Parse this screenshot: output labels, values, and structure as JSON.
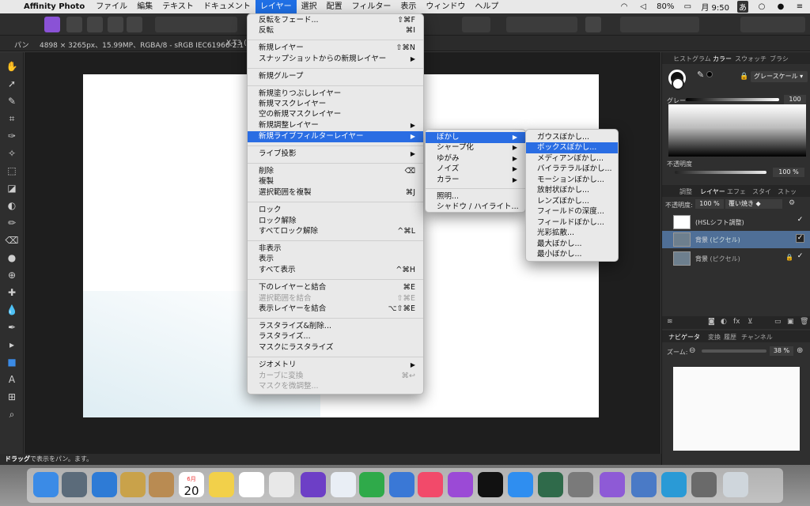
{
  "menubar": {
    "app_name": "Affinity Photo",
    "menus": [
      "ファイル",
      "編集",
      "テキスト",
      "ドキュメント",
      "レイヤー",
      "選択",
      "配置",
      "フィルター",
      "表示",
      "ウィンドウ",
      "ヘルプ"
    ],
    "active_menu": "レイヤー",
    "battery": "80%",
    "clock": "月 9:50",
    "input_method": "あ"
  },
  "contextbar": {
    "tool": "パン",
    "info": "4898 × 3265px、15.99MP、RGBA/8 - sRGB IEC61966-2.1",
    "camera": "X-T3 (X"
  },
  "status": {
    "bold": "ドラッグ",
    "rest": "で表示をパン。ます。"
  },
  "layer_menu": {
    "items": [
      {
        "label": "反転をフェード...",
        "shortcut": "⇧⌘F"
      },
      {
        "label": "反転",
        "shortcut": "⌘I"
      },
      {
        "label": "新規レイヤー",
        "shortcut": "⇧⌘N"
      },
      {
        "label": "スナップショットからの新規レイヤー",
        "arrow": "▶"
      },
      {
        "label": "新規グループ"
      },
      {
        "label": "新規塗りつぶしレイヤー"
      },
      {
        "label": "新規マスクレイヤー"
      },
      {
        "label": "空の新規マスクレイヤー"
      },
      {
        "label": "新規調整レイヤー",
        "arrow": "▶"
      },
      {
        "label": "新規ライブフィルターレイヤー",
        "arrow": "▶"
      },
      {
        "label": "ライブ投影",
        "arrow": "▶"
      },
      {
        "label": "削除",
        "shortcut": "⌫"
      },
      {
        "label": "複製"
      },
      {
        "label": "選択範囲を複製",
        "shortcut": "⌘J"
      },
      {
        "label": "ロック"
      },
      {
        "label": "ロック解除"
      },
      {
        "label": "すべてロック解除",
        "shortcut": "^⌘L"
      },
      {
        "label": "非表示"
      },
      {
        "label": "表示"
      },
      {
        "label": "すべて表示",
        "shortcut": "^⌘H"
      },
      {
        "label": "下のレイヤーと結合",
        "shortcut": "⌘E"
      },
      {
        "label": "選択範囲を結合",
        "shortcut": "⇧⌘E"
      },
      {
        "label": "表示レイヤーを結合",
        "shortcut": "⌥⇧⌘E"
      },
      {
        "label": "ラスタライズ&削除..."
      },
      {
        "label": "ラスタライズ..."
      },
      {
        "label": "マスクにラスタライズ"
      },
      {
        "label": "ジオメトリ",
        "arrow": "▶"
      },
      {
        "label": "カーブに変換",
        "shortcut": "⌘↩"
      },
      {
        "label": "マスクを微調整..."
      }
    ]
  },
  "live_filter_menu": {
    "items": [
      {
        "label": "ぼかし",
        "arrow": "▶"
      },
      {
        "label": "シャープ化",
        "arrow": "▶"
      },
      {
        "label": "ゆがみ",
        "arrow": "▶"
      },
      {
        "label": "ノイズ",
        "arrow": "▶"
      },
      {
        "label": "カラー",
        "arrow": "▶"
      },
      {
        "label": "照明..."
      },
      {
        "label": "シャドウ / ハイライト..."
      }
    ]
  },
  "blur_menu": {
    "items": [
      {
        "label": "ガウスぼかし..."
      },
      {
        "label": "ボックスぼかし..."
      },
      {
        "label": "メディアンぼかし..."
      },
      {
        "label": "バイラテラルぼかし..."
      },
      {
        "label": "モーションぼかし..."
      },
      {
        "label": "放射状ぼかし..."
      },
      {
        "label": "レンズぼかし..."
      },
      {
        "label": "フィールドの深度..."
      },
      {
        "label": "フィールドぼかし..."
      },
      {
        "label": "光彩拡散..."
      },
      {
        "label": "最大ぼかし..."
      },
      {
        "label": "最小ぼかし..."
      }
    ]
  },
  "color_panel": {
    "tabs": [
      "ヒストグラム",
      "カラー",
      "スウォッチ",
      "ブラシ"
    ],
    "mode": "グレースケール",
    "gray_label": "グレー",
    "gray_value": "100",
    "opacity_label": "不透明度",
    "opacity_value": "100 %"
  },
  "layers_panel": {
    "tabs": [
      "調整",
      "レイヤー",
      "エフェ",
      "スタイ",
      "ストッ"
    ],
    "opacity_label": "不透明度:",
    "opacity_value": "100 %",
    "blend_mode": "覆い焼き",
    "layers": [
      {
        "name": "(HSLシフト調整)"
      },
      {
        "name": "背景",
        "kind": "(ピクセル)"
      },
      {
        "name": "背景",
        "kind": "(ピクセル)"
      }
    ]
  },
  "navigator_panel": {
    "tabs": [
      "ナビゲータ",
      "変換",
      "履歴",
      "チャンネル"
    ],
    "zoom_label": "ズーム:",
    "zoom_value": "38 %"
  },
  "dock": {
    "calendar_month": "6月",
    "calendar_day": "20",
    "apps": [
      "Finder",
      "Launchpad",
      "Safari",
      "Preview",
      "Contacts",
      "Calendar",
      "Notes",
      "Reminders",
      "Photos",
      "Affinity",
      "Keynote-like",
      "Numbers",
      "Keynote",
      "Music",
      "Podcasts",
      "TV",
      "App Store",
      "Time Machine",
      "System Preferences",
      "Affinity Photo",
      "Preview2",
      "Affinity Designer",
      "Photo Browser",
      "Trash"
    ]
  }
}
